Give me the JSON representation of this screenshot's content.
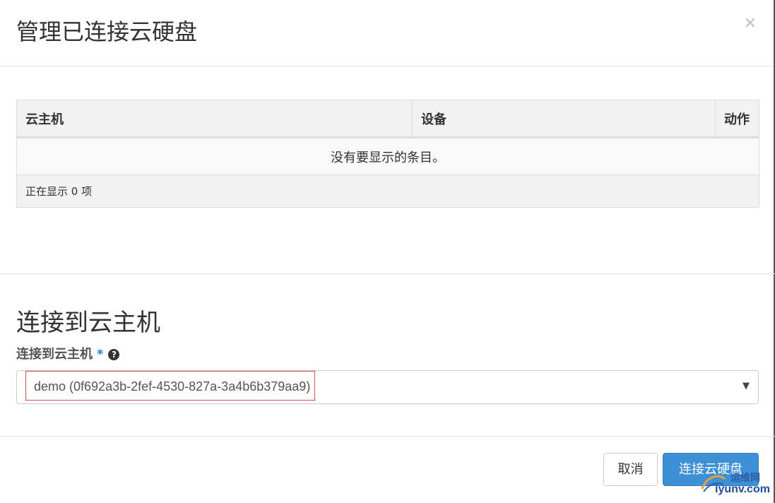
{
  "modal": {
    "title": "管理已连接云硬盘",
    "close_glyph": "×"
  },
  "table": {
    "headers": {
      "instance": "云主机",
      "device": "设备",
      "actions": "动作"
    },
    "empty_message": "没有要显示的条目。",
    "footer": "正在显示 0 项"
  },
  "attach": {
    "section_title": "连接到云主机",
    "field_label": "连接到云主机",
    "required_mark": "*",
    "help_glyph": "?",
    "selected_value": "demo (0f692a3b-2fef-4530-827a-3a4b6b379aa9)",
    "arrow_glyph": "▼"
  },
  "footer": {
    "cancel_label": "取消",
    "submit_label": "连接云硬盘"
  },
  "watermark": {
    "line1": "运维网",
    "line2": "iyunv.com"
  },
  "colors": {
    "primary": "#3d8fd6",
    "highlight_border": "#d9534f",
    "required": "#2f83c5"
  }
}
